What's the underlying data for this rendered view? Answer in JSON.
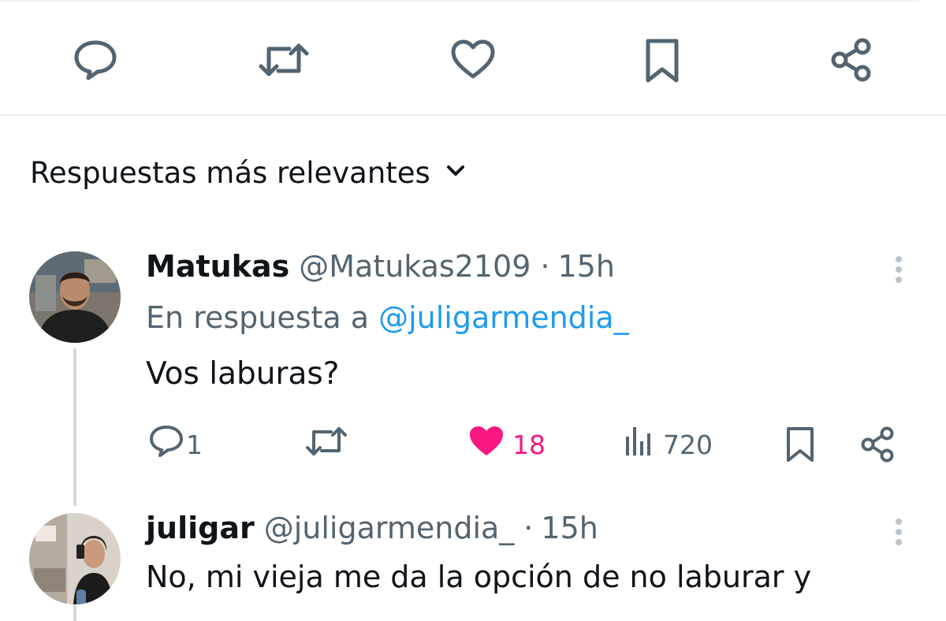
{
  "top_actions": {
    "icons": [
      "reply-icon",
      "retweet-icon",
      "like-icon",
      "bookmark-icon",
      "share-icon"
    ]
  },
  "replies_header": {
    "sort_label": "Respuestas más relevantes",
    "chevron_icon": "chevron-down-icon"
  },
  "replies": [
    {
      "display_name": "Matukas",
      "handle": "@Matukas2109",
      "separator": "·",
      "time": "15h",
      "reply_to_prefix": "En respuesta a",
      "reply_to_handle": "@juligarmendia_",
      "text": "Vos laburas?",
      "stats": {
        "replies": "1",
        "retweets": "",
        "likes": "18",
        "views": "720"
      },
      "liked": true
    },
    {
      "display_name": "juligar",
      "handle": "@juligarmendia_",
      "separator": "·",
      "time": "15h",
      "text": "No, mi vieja me da la opción de no laburar y"
    }
  ],
  "colors": {
    "text_primary": "#0f1419",
    "text_secondary": "#536471",
    "link": "#1d9bf0",
    "like_active": "#f91880",
    "divider": "#e6ecf0"
  }
}
